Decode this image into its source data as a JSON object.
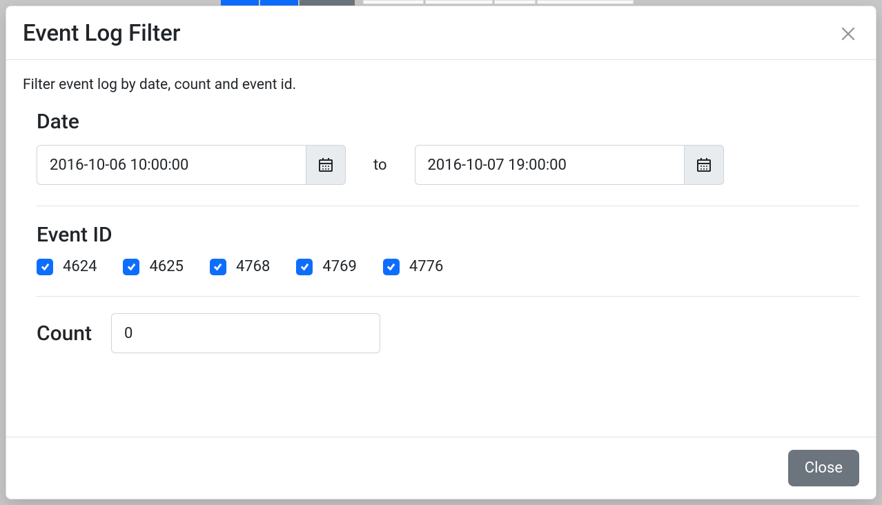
{
  "modal": {
    "title": "Event Log Filter",
    "description": "Filter event log by date, count and event id.",
    "sections": {
      "date": {
        "title": "Date",
        "from": "2016-10-06 10:00:00",
        "to_label": "to",
        "to": "2016-10-07 19:00:00"
      },
      "event_id": {
        "title": "Event ID",
        "options": [
          {
            "label": "4624",
            "checked": true
          },
          {
            "label": "4625",
            "checked": true
          },
          {
            "label": "4768",
            "checked": true
          },
          {
            "label": "4769",
            "checked": true
          },
          {
            "label": "4776",
            "checked": true
          }
        ]
      },
      "count": {
        "title": "Count",
        "value": "0"
      }
    },
    "footer": {
      "close": "Close"
    }
  }
}
